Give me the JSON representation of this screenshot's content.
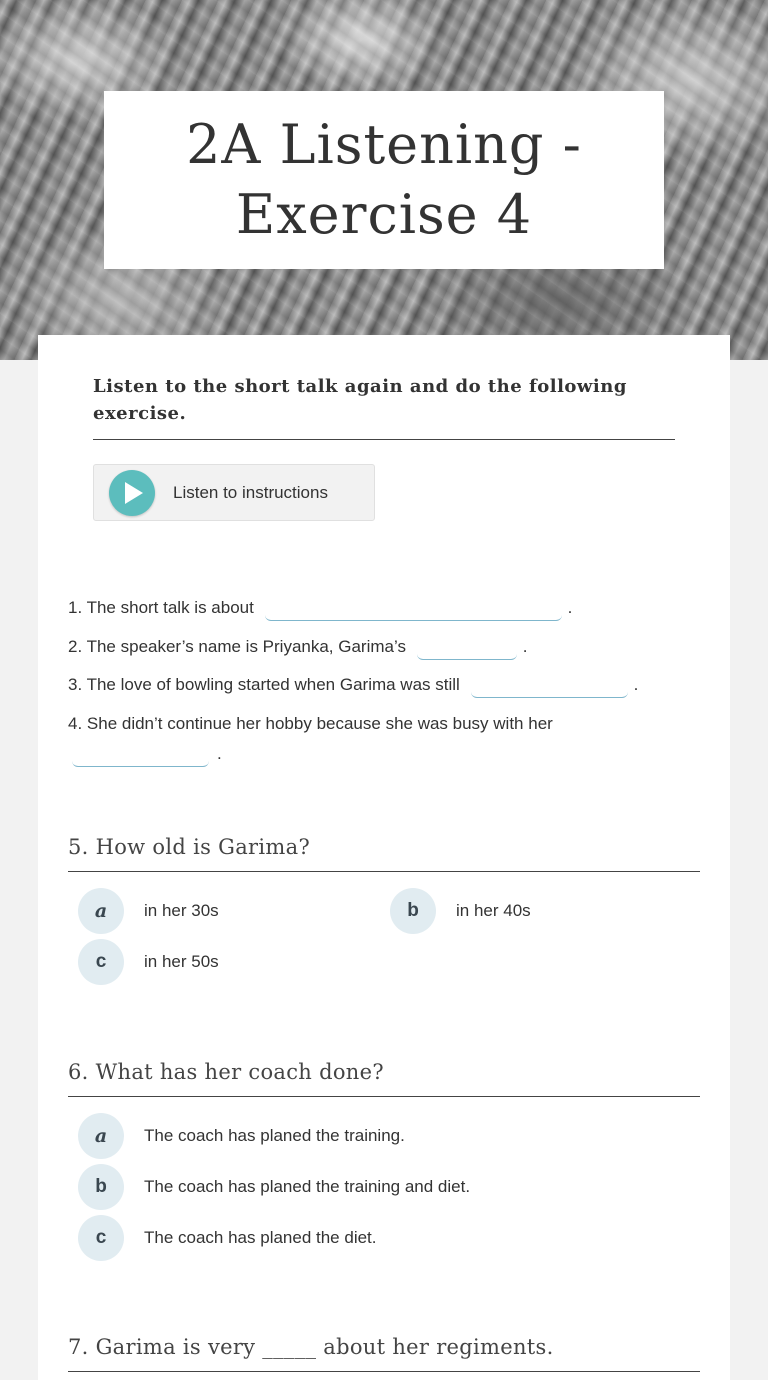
{
  "title": "2A Listening - Exercise 4",
  "instructions": "Listen to the short talk again and do the following exercise.",
  "listen_button": {
    "label": "Listen to instructions",
    "icon": "play-icon",
    "color": "#5cbdbd"
  },
  "fill_in": {
    "q1": {
      "before": "1. The short talk is about",
      "after": "."
    },
    "q2": {
      "before": "2. The speaker’s name is Priyanka, Garima’s",
      "after": "."
    },
    "q3": {
      "before": "3. The love of bowling started when Garima was still",
      "after": "."
    },
    "q4": {
      "before": "4. She didn’t continue her hobby because she was busy with her",
      "after": "."
    }
  },
  "questions": [
    {
      "title": "5. How old is Garima?",
      "options": [
        {
          "letter": "a",
          "text": "in her 30s"
        },
        {
          "letter": "b",
          "text": "in her 40s"
        },
        {
          "letter": "c",
          "text": "in her 50s"
        }
      ]
    },
    {
      "title": "6. What has her coach done?",
      "options": [
        {
          "letter": "a",
          "text": "The coach has planed the training."
        },
        {
          "letter": "b",
          "text": "The coach has planed the training and diet."
        },
        {
          "letter": "c",
          "text": "The coach has planed the diet."
        }
      ]
    },
    {
      "title": "7. Garima is very _____ about her regiments.",
      "options": []
    }
  ],
  "colors": {
    "accent": "#5cbdbd",
    "option_bubble": "#e1ecf1",
    "blank_underline": "#7fb6cc"
  }
}
